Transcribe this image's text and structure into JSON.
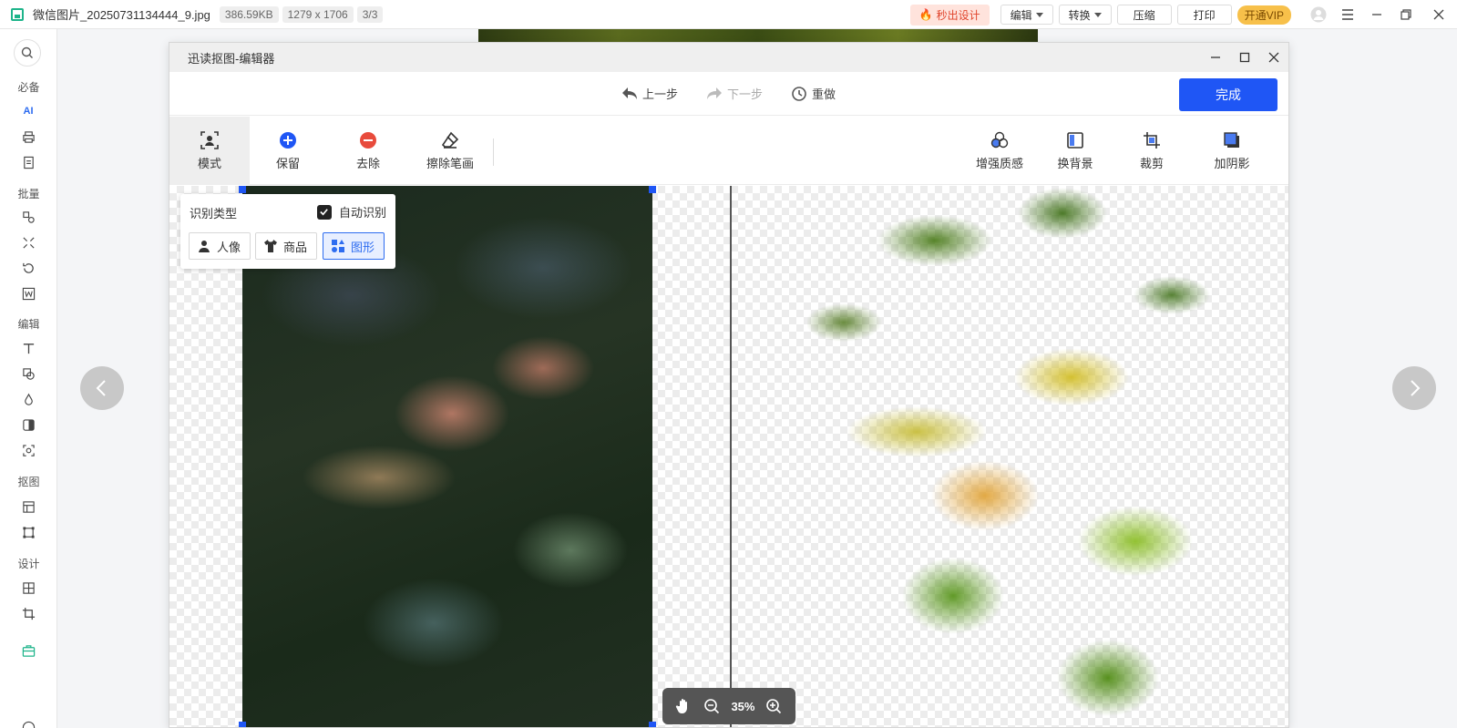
{
  "topbar": {
    "filename": "微信图片_20250731134444_9.jpg",
    "filesize": "386.59KB",
    "dimensions": "1279 x 1706",
    "counter": "3/3",
    "hot_label": "秒出设计",
    "edit_label": "编辑",
    "convert_label": "转换",
    "compress_label": "压缩",
    "print_label": "打印",
    "vip_label": "开通VIP"
  },
  "sidebar": {
    "group_essentials": "必备",
    "group_batch": "批量",
    "group_edit": "编辑",
    "group_cutout": "抠图",
    "group_design": "设计",
    "ai_label": "AI"
  },
  "dialog": {
    "title": "迅读抠图-编辑器",
    "undo_label": "上一步",
    "redo_label": "下一步",
    "reset_label": "重做",
    "done_label": "完成",
    "tools": {
      "mode": "模式",
      "keep": "保留",
      "remove": "去除",
      "erase": "擦除笔画",
      "enhance": "增强质感",
      "background": "换背景",
      "crop": "裁剪",
      "shadow": "加阴影"
    },
    "recognition": {
      "title": "识别类型",
      "auto_label": "自动识别",
      "auto_checked": true,
      "options": [
        "人像",
        "商品",
        "图形"
      ],
      "selected": "图形"
    },
    "zoom_value": "35%"
  },
  "colors": {
    "accent": "#1f56f5",
    "hot": "#e0452d",
    "vip": "#f7c04a",
    "remove_red": "#e84b3c"
  }
}
